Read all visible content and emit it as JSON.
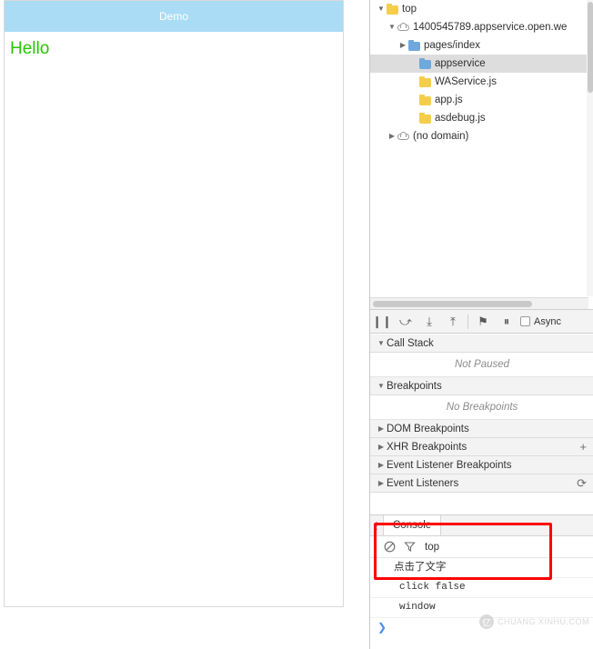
{
  "simulator": {
    "title": "Demo",
    "body_text": "Hello"
  },
  "sources": {
    "tree": [
      {
        "indent": 0,
        "twisty": "▼",
        "icon": "folder-icon",
        "icon_color": "yellow",
        "label": "top",
        "selected": false
      },
      {
        "indent": 1,
        "twisty": "▼",
        "icon": "cloud-icon",
        "icon_color": "white",
        "label": "1400545789.appservice.open.we",
        "selected": false
      },
      {
        "indent": 2,
        "twisty": "▶",
        "icon": "folder-icon",
        "icon_color": "blue",
        "label": "pages/index",
        "selected": false
      },
      {
        "indent": 3,
        "twisty": "",
        "icon": "folder-icon",
        "icon_color": "blue",
        "label": "appservice",
        "selected": true
      },
      {
        "indent": 3,
        "twisty": "",
        "icon": "folder-icon",
        "icon_color": "yellow",
        "label": "WAService.js",
        "selected": false
      },
      {
        "indent": 3,
        "twisty": "",
        "icon": "folder-icon",
        "icon_color": "yellow",
        "label": "app.js",
        "selected": false
      },
      {
        "indent": 3,
        "twisty": "",
        "icon": "folder-icon",
        "icon_color": "yellow",
        "label": "asdebug.js",
        "selected": false
      },
      {
        "indent": 1,
        "twisty": "▶",
        "icon": "cloud-icon",
        "icon_color": "white",
        "label": "(no domain)",
        "selected": false
      }
    ]
  },
  "debugger_toolbar": {
    "buttons": [
      {
        "name": "pause-resume-button",
        "glyph": "❙❙"
      },
      {
        "name": "step-over-button",
        "glyph": "⤻"
      },
      {
        "name": "step-into-button",
        "glyph": "⤓"
      },
      {
        "name": "step-out-button",
        "glyph": "⤒"
      },
      {
        "name": "deactivate-breakpoints-button",
        "glyph": "⚑"
      },
      {
        "name": "pause-on-exceptions-button",
        "glyph": "⏸"
      }
    ],
    "async_label": "Async"
  },
  "side_panes": [
    {
      "name": "call-stack",
      "twisty": "▼",
      "title": "Call Stack",
      "empty_text": "Not Paused",
      "action": ""
    },
    {
      "name": "breakpoints",
      "twisty": "▼",
      "title": "Breakpoints",
      "empty_text": "No Breakpoints",
      "action": ""
    },
    {
      "name": "dom-breakpoints",
      "twisty": "▶",
      "title": "DOM Breakpoints",
      "empty_text": "",
      "action": ""
    },
    {
      "name": "xhr-breakpoints",
      "twisty": "▶",
      "title": "XHR Breakpoints",
      "empty_text": "",
      "action": "+"
    },
    {
      "name": "event-listener-breakpoints",
      "twisty": "▶",
      "title": "Event Listener Breakpoints",
      "empty_text": "",
      "action": ""
    },
    {
      "name": "event-listeners",
      "twisty": "▶",
      "title": "Event Listeners",
      "empty_text": "",
      "action": "⟳"
    }
  ],
  "drawer": {
    "tab_label": "Console",
    "dots": "⋮",
    "clear_icon": "clear-console-icon",
    "filter_icon": "filter-icon",
    "context": "top",
    "messages": [
      {
        "text": "点击了文字",
        "mono": false
      },
      {
        "text": "click false",
        "mono": true
      },
      {
        "text": "window",
        "mono": true
      }
    ],
    "prompt": "❯"
  },
  "annotation": {
    "highlight_color": "#ff0000"
  },
  "watermark": {
    "logo": "亿",
    "text": "CHUANG XINHU.COM"
  }
}
